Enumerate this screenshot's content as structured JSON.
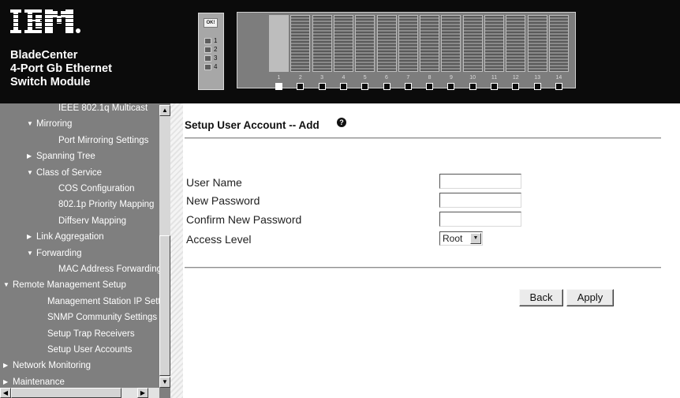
{
  "header": {
    "logo_text": "IBM",
    "product_lines": [
      "BladeCenter",
      "4-Port Gb Ethernet",
      "Switch Module"
    ],
    "ok_led": "OK!",
    "ports": [
      "1",
      "2",
      "3",
      "4"
    ],
    "bays": [
      "1",
      "2",
      "3",
      "4",
      "5",
      "6",
      "7",
      "8",
      "9",
      "10",
      "11",
      "12",
      "13",
      "14"
    ],
    "selected_bay": 1
  },
  "nav": {
    "items": [
      {
        "label": "IEEE 802.1q Multicast",
        "indent": 4,
        "toggle": ""
      },
      {
        "label": "Mirroring",
        "indent": 2,
        "toggle": "expanded"
      },
      {
        "label": "Port Mirroring Settings",
        "indent": 4,
        "toggle": ""
      },
      {
        "label": "Spanning Tree",
        "indent": 2,
        "toggle": "collapsed"
      },
      {
        "label": "Class of Service",
        "indent": 2,
        "toggle": "expanded"
      },
      {
        "label": "COS Configuration",
        "indent": 4,
        "toggle": ""
      },
      {
        "label": "802.1p Priority Mapping",
        "indent": 4,
        "toggle": ""
      },
      {
        "label": "Diffserv Mapping",
        "indent": 4,
        "toggle": ""
      },
      {
        "label": "Link Aggregation",
        "indent": 2,
        "toggle": "collapsed"
      },
      {
        "label": "Forwarding",
        "indent": 2,
        "toggle": "expanded"
      },
      {
        "label": "MAC Address Forwarding",
        "indent": 4,
        "toggle": ""
      },
      {
        "label": "Remote Management Setup",
        "indent": 1,
        "toggle": "expanded"
      },
      {
        "label": "Management Station IP Settings",
        "indent": 3,
        "toggle": ""
      },
      {
        "label": "SNMP Community Settings",
        "indent": 3,
        "toggle": ""
      },
      {
        "label": "Setup Trap Receivers",
        "indent": 3,
        "toggle": ""
      },
      {
        "label": "Setup User Accounts",
        "indent": 3,
        "toggle": ""
      },
      {
        "label": "Network Monitoring",
        "indent": 1,
        "toggle": "collapsed"
      },
      {
        "label": "Maintenance",
        "indent": 1,
        "toggle": "collapsed"
      }
    ]
  },
  "main": {
    "title": "Setup User Account -- Add",
    "form": {
      "user_name_label": "User Name",
      "user_name_value": "",
      "new_password_label": "New Password",
      "new_password_value": "",
      "confirm_password_label": "Confirm New Password",
      "confirm_password_value": "",
      "access_level_label": "Access Level",
      "access_level_value": "Root"
    },
    "buttons": {
      "back": "Back",
      "apply": "Apply"
    }
  }
}
